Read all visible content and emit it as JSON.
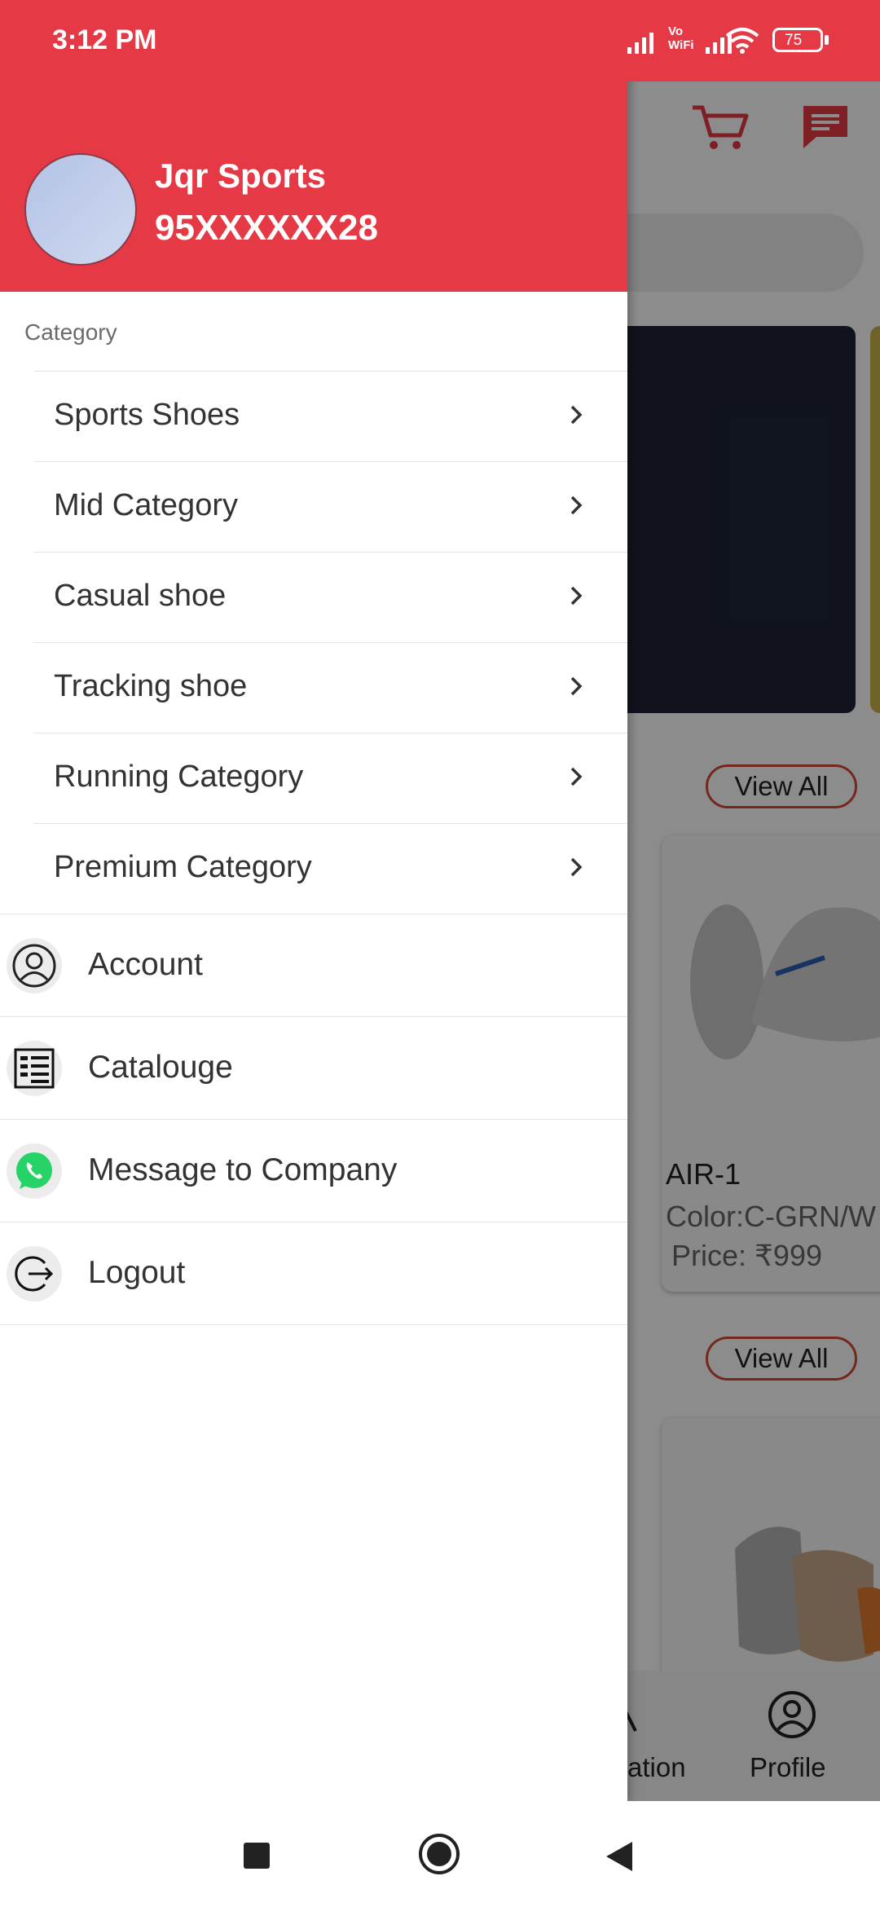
{
  "status_bar": {
    "time": "3:12 PM",
    "network_label": "Vo WiFi",
    "battery": "75"
  },
  "drawer": {
    "user_name": "Jqr Sports",
    "user_phone": "95XXXXXX28",
    "category_header": "Category",
    "categories": [
      {
        "label": "Sports Shoes"
      },
      {
        "label": "Mid Category"
      },
      {
        "label": "Casual shoe"
      },
      {
        "label": "Tracking shoe"
      },
      {
        "label": "Running Category"
      },
      {
        "label": "Premium Category"
      }
    ],
    "menu": [
      {
        "label": "Account",
        "icon": "account-icon"
      },
      {
        "label": "Catalouge",
        "icon": "catalogue-icon"
      },
      {
        "label": "Message to Company",
        "icon": "whatsapp-icon"
      },
      {
        "label": "Logout",
        "icon": "logout-icon"
      }
    ]
  },
  "background": {
    "view_all_1": "View All",
    "view_all_2": "View All",
    "product_name": "AIR-1",
    "product_color": "Color:C-GRN/W",
    "product_price": "Price: ₹999",
    "nav_partial_label": "ation",
    "nav_profile_label": "Profile"
  },
  "colors": {
    "brand_red": "#e63946",
    "whatsapp_green": "#25d366",
    "view_all_border": "#d44a32"
  }
}
